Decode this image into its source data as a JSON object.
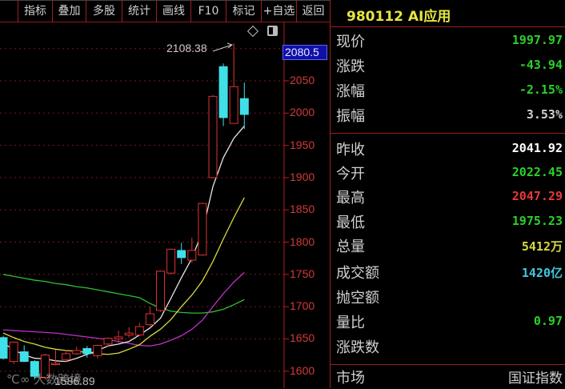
{
  "toolbar": {
    "items": [
      "指标",
      "叠加",
      "多股",
      "统计",
      "画线",
      "F10",
      "标记",
      "+自选",
      "返回"
    ]
  },
  "chart_icons": [
    "diamond-icon",
    "panel-toggle-icon"
  ],
  "axis": {
    "current_price_label": "2080.5",
    "ticks": [
      "2050",
      "2000",
      "1950",
      "1900",
      "1850",
      "1800",
      "1750",
      "1700",
      "1650",
      "1600"
    ]
  },
  "annotations": {
    "high_label": "2108.38",
    "low_label": "1586.89"
  },
  "watermark": "大数跨境",
  "colors": {
    "up": "#e03232",
    "down": "#40e0e8",
    "ma5": "#e8e8e8",
    "ma10": "#d8d840",
    "ma20": "#c030c8",
    "ma60": "#30c030"
  },
  "chart_data": {
    "type": "candlestick",
    "ylim": [
      1580,
      2120
    ],
    "grid_levels": [
      2100,
      2050,
      2000,
      1950,
      1900,
      1850,
      1800,
      1750,
      1700,
      1650,
      1600
    ],
    "candles": [
      {
        "o": 1652,
        "c": 1620,
        "h": 1655,
        "l": 1618
      },
      {
        "o": 1615,
        "c": 1645,
        "h": 1646,
        "l": 1611
      },
      {
        "o": 1630,
        "c": 1615,
        "h": 1640,
        "l": 1614
      },
      {
        "o": 1615,
        "c": 1592,
        "h": 1617,
        "l": 1587
      },
      {
        "o": 1590,
        "c": 1625,
        "h": 1627,
        "l": 1587
      },
      {
        "o": 1611,
        "c": 1612,
        "h": 1633,
        "l": 1609
      },
      {
        "o": 1618,
        "c": 1627,
        "h": 1633,
        "l": 1614
      },
      {
        "o": 1627,
        "c": 1632,
        "h": 1638,
        "l": 1625
      },
      {
        "o": 1635,
        "c": 1627,
        "h": 1639,
        "l": 1621
      },
      {
        "o": 1624,
        "c": 1640,
        "h": 1641,
        "l": 1620
      },
      {
        "o": 1642,
        "c": 1651,
        "h": 1652,
        "l": 1638
      },
      {
        "o": 1650,
        "c": 1653,
        "h": 1663,
        "l": 1644
      },
      {
        "o": 1656,
        "c": 1659,
        "h": 1668,
        "l": 1652
      },
      {
        "o": 1656,
        "c": 1669,
        "h": 1675,
        "l": 1654
      },
      {
        "o": 1672,
        "c": 1689,
        "h": 1700,
        "l": 1670
      },
      {
        "o": 1694,
        "c": 1755,
        "h": 1756,
        "l": 1692
      },
      {
        "o": 1752,
        "c": 1789,
        "h": 1790,
        "l": 1750
      },
      {
        "o": 1787,
        "c": 1776,
        "h": 1799,
        "l": 1766
      },
      {
        "o": 1772,
        "c": 1787,
        "h": 1807,
        "l": 1768
      },
      {
        "o": 1780,
        "c": 1860,
        "h": 1861,
        "l": 1779
      },
      {
        "o": 1900,
        "c": 2026,
        "h": 2028,
        "l": 1899
      },
      {
        "o": 2072,
        "c": 1993,
        "h": 2077,
        "l": 1980
      },
      {
        "o": 1984,
        "c": 2041,
        "h": 2108.38,
        "l": 1984
      },
      {
        "o": 2022.45,
        "c": 1997.97,
        "h": 2047.29,
        "l": 1975.23
      }
    ],
    "series": [
      {
        "name": "MA5",
        "values": [
          1644,
          1633,
          1625,
          1620,
          1619,
          1616,
          1615,
          1620,
          1626,
          1632,
          1639,
          1642,
          1646,
          1656,
          1667,
          1682,
          1713,
          1745,
          1775,
          1816,
          1886,
          1931,
          1961,
          1980
        ]
      },
      {
        "name": "MA10",
        "values": [
          1659,
          1652,
          1646,
          1642,
          1637,
          1634,
          1632,
          1631,
          1629,
          1627,
          1626,
          1628,
          1634,
          1641,
          1654,
          1665,
          1680,
          1700,
          1718,
          1740,
          1770,
          1805,
          1838,
          1869
        ]
      },
      {
        "name": "MA20",
        "values": [
          1664,
          1663,
          1662,
          1661,
          1660,
          1659,
          1657,
          1655,
          1653,
          1651,
          1649,
          1646,
          1643,
          1640,
          1639,
          1642,
          1648,
          1655,
          1665,
          1679,
          1700,
          1720,
          1738,
          1753
        ]
      },
      {
        "name": "MA60",
        "values": [
          1750,
          1747,
          1744,
          1741,
          1739,
          1736,
          1734,
          1731,
          1729,
          1726,
          1723,
          1720,
          1717,
          1714,
          1705,
          1698,
          1693,
          1691,
          1690,
          1690,
          1692,
          1696,
          1703,
          1711
        ]
      }
    ]
  },
  "panel": {
    "title": "980112 AI应用",
    "rows": [
      {
        "label": "现价",
        "value": "1997.97",
        "color": "#2ad02a"
      },
      {
        "label": "涨跌",
        "value": "-43.94",
        "color": "#2ad02a"
      },
      {
        "label": "涨幅",
        "value": "-2.15%",
        "color": "#2ad02a"
      },
      {
        "label": "振幅",
        "value": "3.53%",
        "color": "#d0d0d0"
      },
      {
        "label": "昨收",
        "value": "2041.92",
        "color": "#ffffff"
      },
      {
        "label": "今开",
        "value": "2022.45",
        "color": "#2ad02a"
      },
      {
        "label": "最高",
        "value": "2047.29",
        "color": "#e83838"
      },
      {
        "label": "最低",
        "value": "1975.23",
        "color": "#2ad02a"
      },
      {
        "label": "总量",
        "value": "5412万",
        "color": "#d8d840"
      },
      {
        "label": "成交额",
        "value": "1420亿",
        "color": "#40c8e0"
      },
      {
        "label": "抛空额",
        "value": "",
        "color": "#d0d0d0"
      },
      {
        "label": "量比",
        "value": "0.97",
        "color": "#2ad02a"
      },
      {
        "label": "涨跌数",
        "value": "",
        "color": "#d0d0d0"
      }
    ],
    "market_label": "市场",
    "market_value": "国证指数"
  }
}
